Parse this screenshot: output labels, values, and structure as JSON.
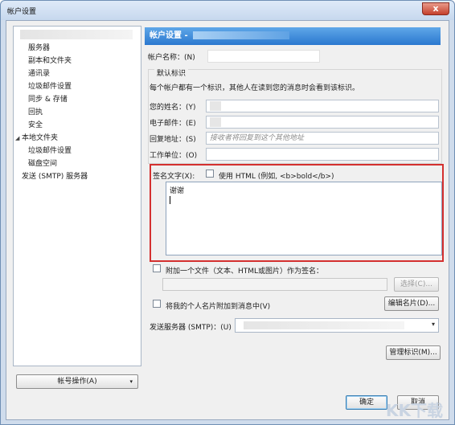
{
  "window": {
    "title": "帐户设置",
    "close_label": "x"
  },
  "sidebar": {
    "items": [
      {
        "label": "服务器",
        "indent": 1
      },
      {
        "label": "副本和文件夹",
        "indent": 1
      },
      {
        "label": "通讯录",
        "indent": 1
      },
      {
        "label": "垃圾邮件设置",
        "indent": 1
      },
      {
        "label": "同步 & 存储",
        "indent": 1
      },
      {
        "label": "回执",
        "indent": 1
      },
      {
        "label": "安全",
        "indent": 1
      },
      {
        "label": "本地文件夹",
        "indent": 0,
        "expander": "◢"
      },
      {
        "label": "垃圾邮件设置",
        "indent": 1
      },
      {
        "label": "磁盘空间",
        "indent": 1
      },
      {
        "label": "发送 (SMTP) 服务器",
        "indent": 0
      }
    ],
    "account_actions_label": "帐号操作(A)",
    "account_actions_caret": "▾"
  },
  "panel": {
    "header_title": "帐户设置 -",
    "account_name_label": "帐户名称：(N)",
    "default_identity_legend": "默认标识",
    "identity_desc": "每个帐户都有一个标识，其他人在读到您的消息时会看到该标识。",
    "your_name_label": "您的姓名：(Y)",
    "email_label": "电子邮件：(E)",
    "reply_to_label": "回复地址：(S)",
    "reply_to_placeholder": "接收者将回复到这个其他地址",
    "org_label": "工作单位：(O)",
    "signature_label": "签名文字(X):",
    "use_html_label": "使用 HTML (例如, <b>bold</b>)",
    "signature_text": "谢谢",
    "attach_file_label": "附加一个文件（文本、HTML或图片）作为签名：",
    "choose_button": "选择(C)...",
    "attach_vcard_label": "将我的个人名片附加到消息中(V)",
    "edit_card_button": "编辑名片(D)...",
    "smtp_label": "发送服务器 (SMTP)：(U)",
    "smtp_arrow": "▾",
    "manage_identities_button": "管理标识(M)...",
    "ok_button": "确定",
    "cancel_button": "取消"
  },
  "watermark": "KK下载"
}
